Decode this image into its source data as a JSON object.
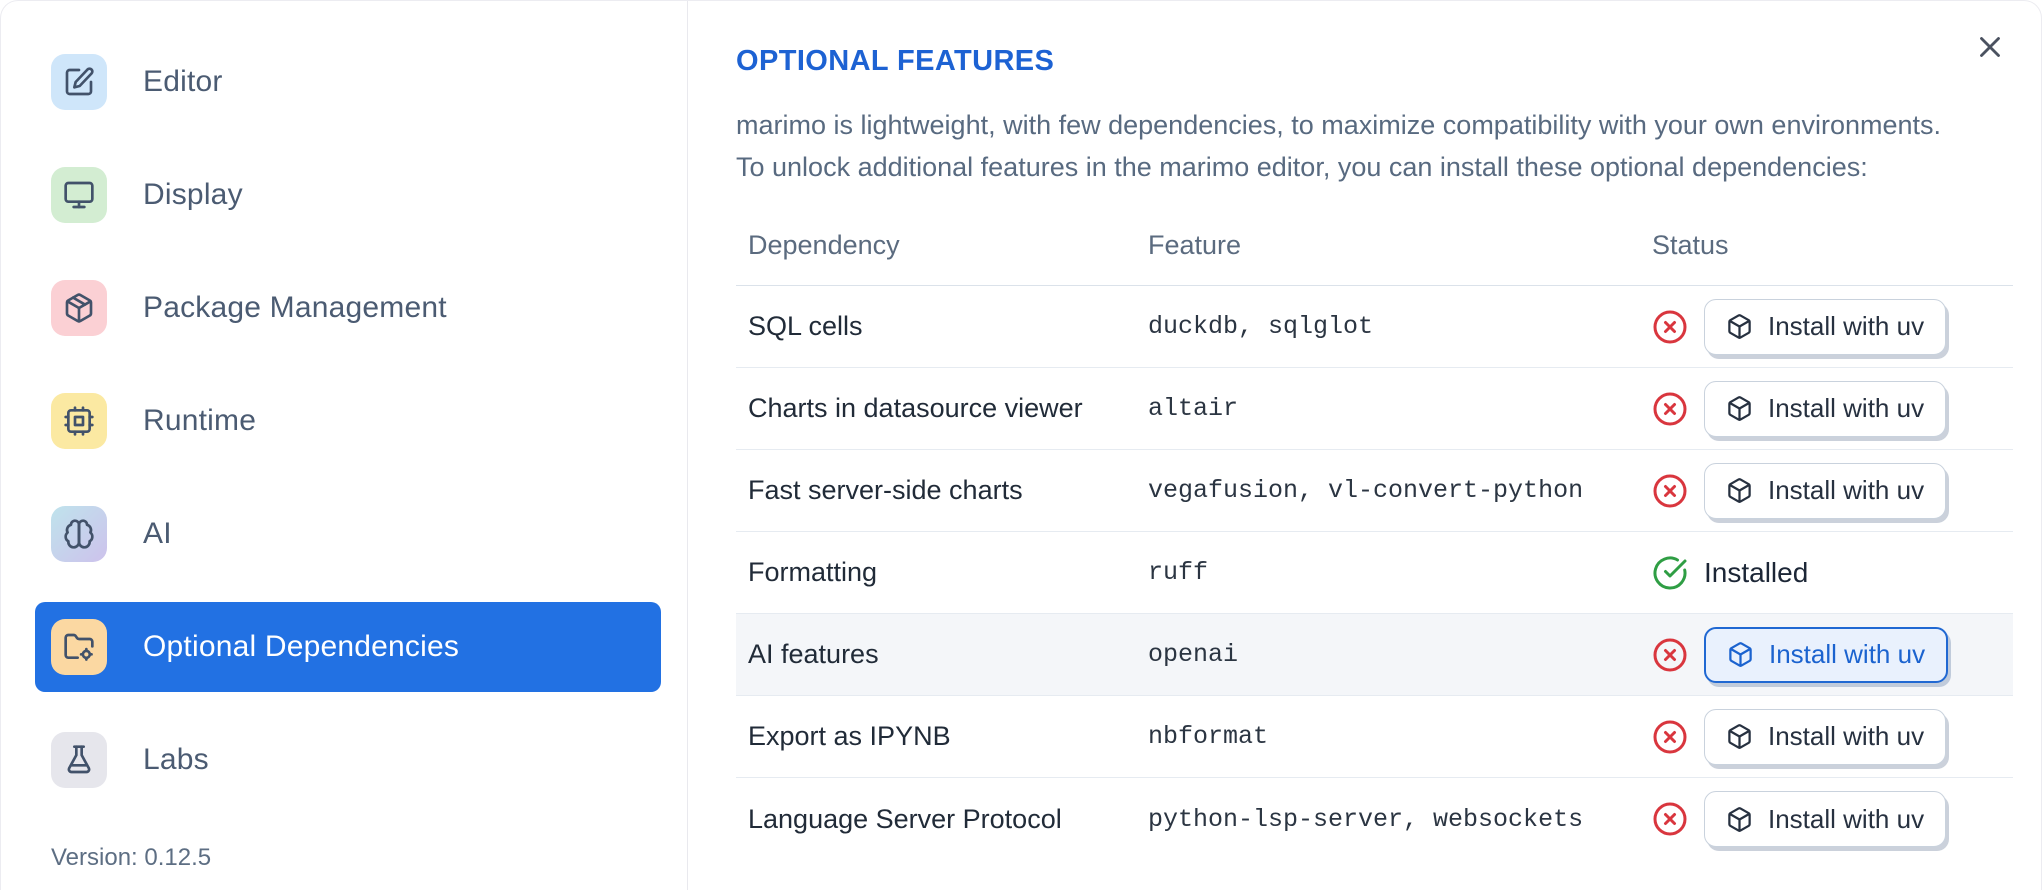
{
  "sidebar": {
    "items": [
      {
        "label": "Editor",
        "icon": "square-pen-icon",
        "icon_bg": "#cfe6fa",
        "selected": false
      },
      {
        "label": "Display",
        "icon": "monitor-icon",
        "icon_bg": "#d3edd2",
        "selected": false
      },
      {
        "label": "Package Management",
        "icon": "package-icon",
        "icon_bg": "#fbd0d4",
        "selected": false
      },
      {
        "label": "Runtime",
        "icon": "cpu-icon",
        "icon_bg": "#fbe9a2",
        "selected": false
      },
      {
        "label": "AI",
        "icon": "brain-icon",
        "icon_bg": "#bfe3ec",
        "icon_bg2": "#cdc2ec",
        "selected": false
      },
      {
        "label": "Optional Dependencies",
        "icon": "folder-cog-icon",
        "icon_bg": "#fbd8a2",
        "selected": true
      },
      {
        "label": "Labs",
        "icon": "flask-icon",
        "icon_bg": "#e6e6ec",
        "selected": false
      }
    ],
    "version_label": "Version: 0.12.5"
  },
  "dialog": {
    "title": "OPTIONAL FEATURES",
    "description_line1": "marimo is lightweight, with few dependencies, to maximize compatibility with your own environments.",
    "description_line2": "To unlock additional features in the marimo editor, you can install these optional dependencies:",
    "close_icon": "x-icon"
  },
  "table": {
    "columns": [
      "Dependency",
      "Feature",
      "Status"
    ],
    "rows": [
      {
        "dependency": "SQL cells",
        "feature": "duckdb, sqlglot",
        "status": "missing",
        "action": "Install with uv",
        "highlighted": false
      },
      {
        "dependency": "Charts in datasource viewer",
        "feature": "altair",
        "status": "missing",
        "action": "Install with uv",
        "highlighted": false
      },
      {
        "dependency": "Fast server-side charts",
        "feature": "vegafusion, vl-convert-python",
        "status": "missing",
        "action": "Install with uv",
        "highlighted": false
      },
      {
        "dependency": "Formatting",
        "feature": "ruff",
        "status": "installed",
        "status_label": "Installed",
        "highlighted": false
      },
      {
        "dependency": "AI features",
        "feature": "openai",
        "status": "missing",
        "action": "Install with uv",
        "highlighted": true
      },
      {
        "dependency": "Export as IPYNB",
        "feature": "nbformat",
        "status": "missing",
        "action": "Install with uv",
        "highlighted": false
      },
      {
        "dependency": "Language Server Protocol",
        "feature": "python-lsp-server, websockets",
        "status": "missing",
        "action": "Install with uv",
        "highlighted": false
      }
    ],
    "status_icons": {
      "missing": "circle-x",
      "installed": "circle-check"
    },
    "install_button_icon": "box"
  },
  "colors": {
    "accent_blue": "#2271e3",
    "title_blue": "#1d62d3",
    "error_red": "#d9363e",
    "success_green": "#2f9e44",
    "highlight_button_bg": "#e9f1fd",
    "highlight_row_bg": "#f4f6f9",
    "sidebar_text": "#4b5b72",
    "body_text": "#586a80",
    "row_text": "#212b38"
  }
}
